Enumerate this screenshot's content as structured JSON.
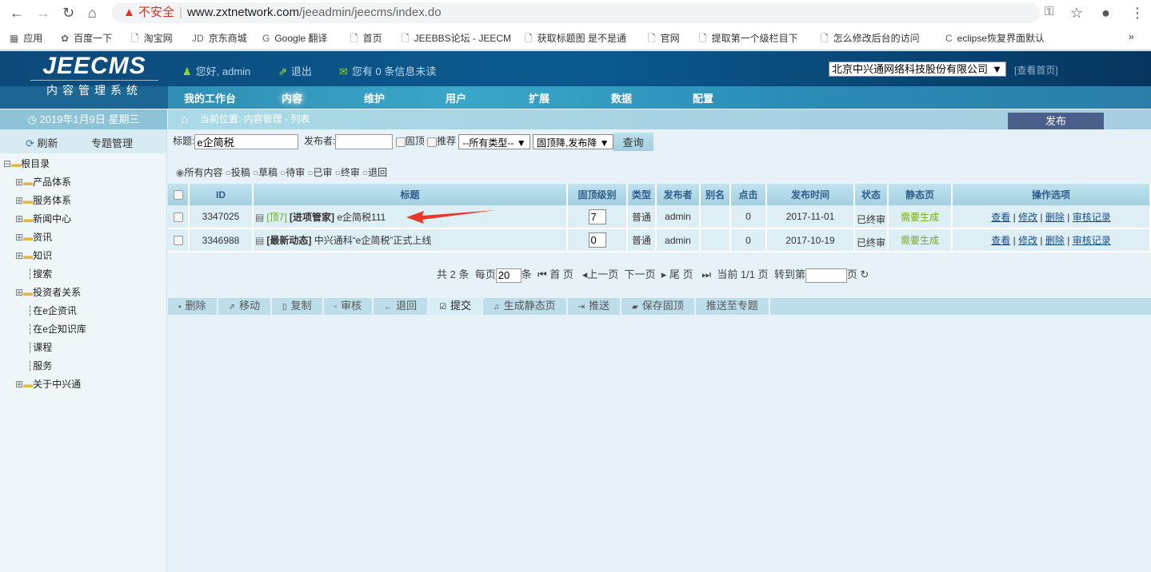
{
  "browser": {
    "warning": "不安全",
    "url_host": "www.zxtnetwork.com",
    "url_path": "/jeeadmin/jeecms/index.do",
    "bookmarks": [
      "应用",
      "百度一下",
      "淘宝网",
      "京东商城",
      "Google 翻译",
      "首页",
      "JEEBBS论坛 - JEECM",
      "获取标题图 是不是通",
      "官网",
      "提取第一个级栏目下",
      "怎么修改后台的访问",
      "eclipse恢复界面默认"
    ],
    "more": "»"
  },
  "header": {
    "logo_main": "JEECMS",
    "logo_sub": "内容管理系统",
    "greeting": "您好, admin",
    "logout": "退出",
    "messages": "您有 0 条信息未读",
    "site": "北京中兴通网络科技股份有限公司",
    "view_home": "[查看首页]"
  },
  "nav": [
    "我的工作台",
    "内容",
    "维护",
    "用户",
    "扩展",
    "数据",
    "配置"
  ],
  "sidebar": {
    "date": "2019年1月9日 星期三",
    "refresh": "刷新",
    "topics": "专题管理",
    "tree": [
      "根目录",
      "产品体系",
      "服务体系",
      "新闻中心",
      "资讯",
      "知识",
      "搜索",
      "投资者关系",
      "在e企资讯",
      "在e企知识库",
      "课程",
      "服务",
      "关于中兴通"
    ]
  },
  "crumb": "当前位置: 内容管理 - 列表",
  "publish": "发布",
  "search": {
    "title_label": "标题:",
    "title_value": "e企简税",
    "author_label": "发布者:",
    "author_value": "",
    "top_label": "固顶",
    "rec_label": "推荐",
    "type": "--所有类型--",
    "sort": "固顶降,发布降",
    "query": "查询"
  },
  "filters": [
    "所有内容",
    "投稿",
    "草稿",
    "待审",
    "已审",
    "终审",
    "退回"
  ],
  "table": {
    "headers": [
      "ID",
      "标题",
      "固顶级别",
      "类型",
      "发布者",
      "别名",
      "点击",
      "发布时间",
      "状态",
      "静态页",
      "操作选项"
    ],
    "rows": [
      {
        "id": "3347025",
        "top_tag": "[顶7]",
        "channel": "[进项管家]",
        "title": "e企简税111",
        "level": "7",
        "type": "普通",
        "author": "admin",
        "alias": "",
        "clicks": "0",
        "date": "2017-11-01",
        "status": "已终审",
        "static": "需要生成"
      },
      {
        "id": "3346988",
        "top_tag": "",
        "channel": "[最新动态]",
        "title": "中兴通科“e企简税”正式上线",
        "level": "0",
        "type": "普通",
        "author": "admin",
        "alias": "",
        "clicks": "0",
        "date": "2017-10-19",
        "status": "已终审",
        "static": "需要生成"
      }
    ],
    "actions": [
      "查看",
      "修改",
      "删除",
      "审核记录"
    ]
  },
  "pager": {
    "total": "共 2 条",
    "per_page_label": "每页",
    "per_page": "20",
    "unit": "条",
    "first": "首 页",
    "prev": "上一页",
    "next": "下一页",
    "last": "尾 页",
    "current": "当前 1/1 页",
    "goto": "转到第",
    "page": "页"
  },
  "toolbar": [
    "删除",
    "移动",
    "复制",
    "审核",
    "退回",
    "提交",
    "生成静态页",
    "推送",
    "保存固顶",
    "推送至专题"
  ]
}
